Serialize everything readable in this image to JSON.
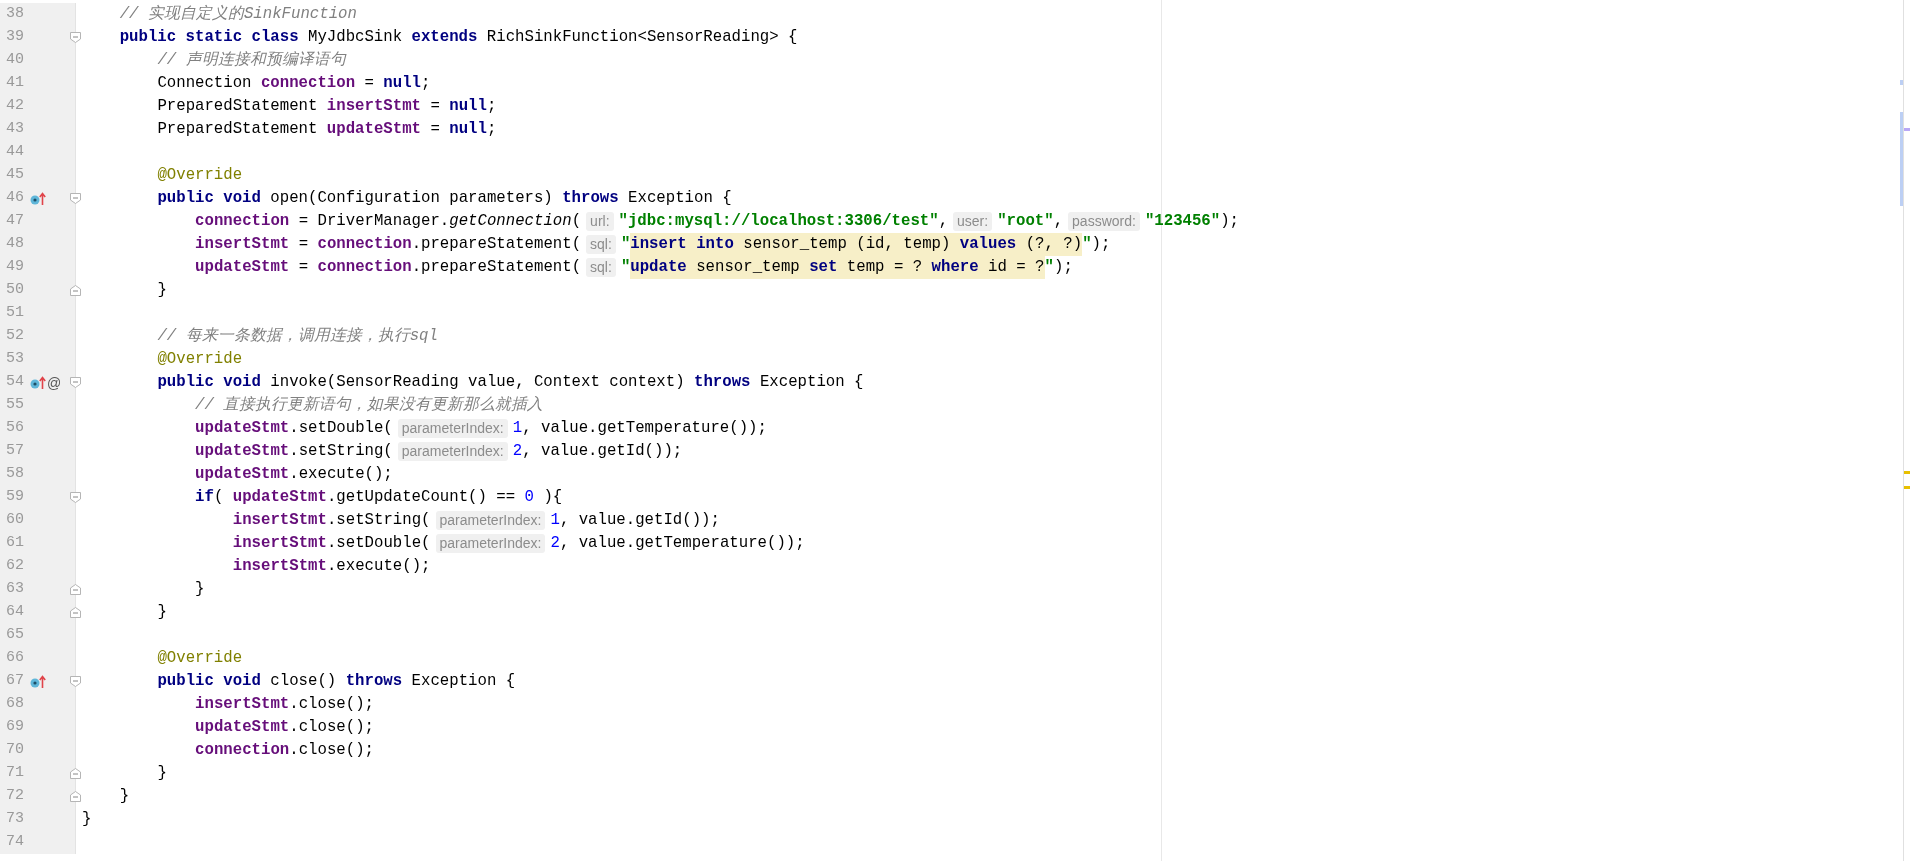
{
  "editor": {
    "lines": [
      {
        "number": "38",
        "kind": "class",
        "segments": [
          {
            "kind": "code",
            "tokens": [
              {
                "kind": "comment",
                "t": "// 实现自定义的SinkFunction"
              }
            ]
          }
        ]
      },
      {
        "number": "39",
        "fold": {
          "kind": "start"
        },
        "kind": "class",
        "segments": [
          {
            "kind": "code",
            "tokens": [
              {
                "kind": "kw",
                "t": "public static class"
              },
              {
                "kind": "plain",
                "t": " MyJdbcSink "
              },
              {
                "kind": "kw",
                "t": "extends"
              },
              {
                "kind": "plain",
                "t": " RichSinkFunction<SensorReading> {"
              }
            ]
          }
        ]
      },
      {
        "number": "40",
        "kind": "member",
        "segments": [
          {
            "kind": "code",
            "tokens": [
              {
                "kind": "comment",
                "t": "// 声明连接和预编译语句"
              }
            ]
          }
        ]
      },
      {
        "number": "41",
        "kind": "member",
        "segments": [
          {
            "kind": "code",
            "tokens": [
              {
                "kind": "plain",
                "t": "Connection "
              },
              {
                "kind": "field",
                "t": "connection"
              },
              {
                "kind": "plain",
                "t": " = "
              },
              {
                "kind": "kw",
                "t": "null"
              },
              {
                "kind": "plain",
                "t": ";"
              }
            ]
          }
        ]
      },
      {
        "number": "42",
        "kind": "member",
        "segments": [
          {
            "kind": "code",
            "tokens": [
              {
                "kind": "plain",
                "t": "PreparedStatement "
              },
              {
                "kind": "field",
                "t": "insertStmt"
              },
              {
                "kind": "plain",
                "t": " = "
              },
              {
                "kind": "kw",
                "t": "null"
              },
              {
                "kind": "plain",
                "t": ";"
              }
            ]
          }
        ]
      },
      {
        "number": "43",
        "kind": "member",
        "segments": [
          {
            "kind": "code",
            "tokens": [
              {
                "kind": "plain",
                "t": "PreparedStatement "
              },
              {
                "kind": "field",
                "t": "updateStmt"
              },
              {
                "kind": "plain",
                "t": " = "
              },
              {
                "kind": "kw",
                "t": "null"
              },
              {
                "kind": "plain",
                "t": ";"
              }
            ]
          }
        ]
      },
      {
        "number": "44"
      },
      {
        "number": "45",
        "kind": "member",
        "segments": [
          {
            "kind": "code",
            "tokens": [
              {
                "kind": "annot",
                "t": "@Override"
              }
            ]
          }
        ]
      },
      {
        "number": "46",
        "gutter": [
          {
            "kind": "override"
          }
        ],
        "fold": {
          "kind": "start"
        },
        "kind": "member",
        "segments": [
          {
            "kind": "code",
            "tokens": [
              {
                "kind": "kw",
                "t": "public void"
              },
              {
                "kind": "plain",
                "t": " open(Configuration parameters) "
              },
              {
                "kind": "kw",
                "t": "throws"
              },
              {
                "kind": "plain",
                "t": " Exception {"
              }
            ]
          }
        ]
      },
      {
        "number": "47",
        "kind": "body",
        "segments": [
          {
            "kind": "code",
            "tokens": [
              {
                "kind": "field",
                "t": "connection"
              },
              {
                "kind": "plain",
                "t": " = DriverManager."
              },
              {
                "kind": "italic",
                "t": "getConnection"
              },
              {
                "kind": "plain",
                "t": "("
              }
            ]
          },
          {
            "kind": "hint",
            "text": "url:"
          },
          {
            "kind": "code",
            "tokens": [
              {
                "kind": "str",
                "t": "\"jdbc:mysql://localhost:3306/test\""
              },
              {
                "kind": "plain",
                "t": ","
              }
            ]
          },
          {
            "kind": "hint",
            "text": "user:"
          },
          {
            "kind": "code",
            "tokens": [
              {
                "kind": "str",
                "t": "\"root\""
              },
              {
                "kind": "plain",
                "t": ","
              }
            ]
          },
          {
            "kind": "hint",
            "text": "password:"
          },
          {
            "kind": "code",
            "tokens": [
              {
                "kind": "str",
                "t": "\"123456\""
              },
              {
                "kind": "plain",
                "t": ");"
              }
            ]
          }
        ]
      },
      {
        "number": "48",
        "kind": "body",
        "segments": [
          {
            "kind": "code",
            "tokens": [
              {
                "kind": "field",
                "t": "insertStmt"
              },
              {
                "kind": "plain",
                "t": " = "
              },
              {
                "kind": "field",
                "t": "connection"
              },
              {
                "kind": "plain",
                "t": ".prepareStatement("
              }
            ]
          },
          {
            "kind": "hint",
            "text": "sql:"
          },
          {
            "kind": "code",
            "tokens": [
              {
                "kind": "str",
                "t": "\""
              }
            ]
          },
          {
            "kind": "sql",
            "tokens": [
              {
                "kind": "kw",
                "t": "insert into"
              },
              {
                "kind": "plain",
                "t": " sensor_temp (id, temp) "
              },
              {
                "kind": "kw",
                "t": "values"
              },
              {
                "kind": "plain",
                "t": " (?, ?)"
              }
            ]
          },
          {
            "kind": "code",
            "tokens": [
              {
                "kind": "str",
                "t": "\""
              },
              {
                "kind": "plain",
                "t": ");"
              }
            ]
          }
        ]
      },
      {
        "number": "49",
        "kind": "body",
        "segments": [
          {
            "kind": "code",
            "tokens": [
              {
                "kind": "field",
                "t": "updateStmt"
              },
              {
                "kind": "plain",
                "t": " = "
              },
              {
                "kind": "field",
                "t": "connection"
              },
              {
                "kind": "plain",
                "t": ".prepareStatement("
              }
            ]
          },
          {
            "kind": "hint",
            "text": "sql:"
          },
          {
            "kind": "code",
            "tokens": [
              {
                "kind": "str",
                "t": "\""
              }
            ]
          },
          {
            "kind": "sql",
            "tokens": [
              {
                "kind": "kw",
                "t": "update"
              },
              {
                "kind": "plain",
                "t": " sensor_temp "
              },
              {
                "kind": "kw",
                "t": "set"
              },
              {
                "kind": "plain",
                "t": " temp = ? "
              },
              {
                "kind": "kw",
                "t": "where"
              },
              {
                "kind": "plain",
                "t": " id = ?"
              }
            ]
          },
          {
            "kind": "code",
            "tokens": [
              {
                "kind": "str",
                "t": "\""
              },
              {
                "kind": "plain",
                "t": ");"
              }
            ]
          }
        ]
      },
      {
        "number": "50",
        "fold": {
          "kind": "end"
        },
        "kind": "member",
        "segments": [
          {
            "kind": "code",
            "tokens": [
              {
                "kind": "plain",
                "t": "}"
              }
            ]
          }
        ]
      },
      {
        "number": "51"
      },
      {
        "number": "52",
        "kind": "member",
        "segments": [
          {
            "kind": "code",
            "tokens": [
              {
                "kind": "comment",
                "t": "// 每来一条数据，调用连接，执行sql"
              }
            ]
          }
        ]
      },
      {
        "number": "53",
        "kind": "member",
        "segments": [
          {
            "kind": "code",
            "tokens": [
              {
                "kind": "annot",
                "t": "@Override"
              }
            ]
          }
        ]
      },
      {
        "number": "54",
        "gutter": [
          {
            "kind": "override"
          },
          {
            "kind": "text",
            "text": "@"
          }
        ],
        "fold": {
          "kind": "start"
        },
        "kind": "member",
        "segments": [
          {
            "kind": "code",
            "tokens": [
              {
                "kind": "kw",
                "t": "public void"
              },
              {
                "kind": "plain",
                "t": " invoke(SensorReading value, Context context) "
              },
              {
                "kind": "kw",
                "t": "throws"
              },
              {
                "kind": "plain",
                "t": " Exception {"
              }
            ]
          }
        ]
      },
      {
        "number": "55",
        "kind": "body",
        "segments": [
          {
            "kind": "code",
            "tokens": [
              {
                "kind": "comment",
                "t": "// 直接执行更新语句，如果没有更新那么就插入"
              }
            ]
          }
        ]
      },
      {
        "number": "56",
        "kind": "body",
        "segments": [
          {
            "kind": "code",
            "tokens": [
              {
                "kind": "field",
                "t": "updateStmt"
              },
              {
                "kind": "plain",
                "t": ".setDouble("
              }
            ]
          },
          {
            "kind": "hint",
            "text": "parameterIndex:"
          },
          {
            "kind": "code",
            "tokens": [
              {
                "kind": "num",
                "t": "1"
              },
              {
                "kind": "plain",
                "t": ", value.getTemperature());"
              }
            ]
          }
        ]
      },
      {
        "number": "57",
        "kind": "body",
        "segments": [
          {
            "kind": "code",
            "tokens": [
              {
                "kind": "field",
                "t": "updateStmt"
              },
              {
                "kind": "plain",
                "t": ".setString("
              }
            ]
          },
          {
            "kind": "hint",
            "text": "parameterIndex:"
          },
          {
            "kind": "code",
            "tokens": [
              {
                "kind": "num",
                "t": "2"
              },
              {
                "kind": "plain",
                "t": ", value.getId());"
              }
            ]
          }
        ]
      },
      {
        "number": "58",
        "kind": "body",
        "segments": [
          {
            "kind": "code",
            "tokens": [
              {
                "kind": "field",
                "t": "updateStmt"
              },
              {
                "kind": "plain",
                "t": ".execute();"
              }
            ]
          }
        ]
      },
      {
        "number": "59",
        "fold": {
          "kind": "start"
        },
        "kind": "body",
        "segments": [
          {
            "kind": "code",
            "tokens": [
              {
                "kind": "kw",
                "t": "if"
              },
              {
                "kind": "plain",
                "t": "( "
              },
              {
                "kind": "field",
                "t": "updateStmt"
              },
              {
                "kind": "plain",
                "t": ".getUpdateCount() == "
              },
              {
                "kind": "num",
                "t": "0"
              },
              {
                "kind": "plain",
                "t": " ){"
              }
            ]
          }
        ]
      },
      {
        "number": "60",
        "kind": "nested",
        "segments": [
          {
            "kind": "code",
            "tokens": [
              {
                "kind": "field",
                "t": "insertStmt"
              },
              {
                "kind": "plain",
                "t": ".setString("
              }
            ]
          },
          {
            "kind": "hint",
            "text": "parameterIndex:"
          },
          {
            "kind": "code",
            "tokens": [
              {
                "kind": "num",
                "t": "1"
              },
              {
                "kind": "plain",
                "t": ", value.getId());"
              }
            ]
          }
        ]
      },
      {
        "number": "61",
        "kind": "nested",
        "segments": [
          {
            "kind": "code",
            "tokens": [
              {
                "kind": "field",
                "t": "insertStmt"
              },
              {
                "kind": "plain",
                "t": ".setDouble("
              }
            ]
          },
          {
            "kind": "hint",
            "text": "parameterIndex:"
          },
          {
            "kind": "code",
            "tokens": [
              {
                "kind": "num",
                "t": "2"
              },
              {
                "kind": "plain",
                "t": ", value.getTemperature());"
              }
            ]
          }
        ]
      },
      {
        "number": "62",
        "kind": "nested",
        "segments": [
          {
            "kind": "code",
            "tokens": [
              {
                "kind": "field",
                "t": "insertStmt"
              },
              {
                "kind": "plain",
                "t": ".execute();"
              }
            ]
          }
        ]
      },
      {
        "number": "63",
        "fold": {
          "kind": "end"
        },
        "kind": "body",
        "segments": [
          {
            "kind": "code",
            "tokens": [
              {
                "kind": "plain",
                "t": "}"
              }
            ]
          }
        ]
      },
      {
        "number": "64",
        "fold": {
          "kind": "end"
        },
        "kind": "member",
        "segments": [
          {
            "kind": "code",
            "tokens": [
              {
                "kind": "plain",
                "t": "}"
              }
            ]
          }
        ]
      },
      {
        "number": "65"
      },
      {
        "number": "66",
        "kind": "member",
        "segments": [
          {
            "kind": "code",
            "tokens": [
              {
                "kind": "annot",
                "t": "@Override"
              }
            ]
          }
        ]
      },
      {
        "number": "67",
        "gutter": [
          {
            "kind": "override"
          }
        ],
        "fold": {
          "kind": "start"
        },
        "kind": "member",
        "segments": [
          {
            "kind": "code",
            "tokens": [
              {
                "kind": "kw",
                "t": "public void"
              },
              {
                "kind": "plain",
                "t": " close() "
              },
              {
                "kind": "kw",
                "t": "throws"
              },
              {
                "kind": "plain",
                "t": " Exception {"
              }
            ]
          }
        ]
      },
      {
        "number": "68",
        "kind": "body",
        "segments": [
          {
            "kind": "code",
            "tokens": [
              {
                "kind": "field",
                "t": "insertStmt"
              },
              {
                "kind": "plain",
                "t": ".close();"
              }
            ]
          }
        ]
      },
      {
        "number": "69",
        "kind": "body",
        "segments": [
          {
            "kind": "code",
            "tokens": [
              {
                "kind": "field",
                "t": "updateStmt"
              },
              {
                "kind": "plain",
                "t": ".close();"
              }
            ]
          }
        ]
      },
      {
        "number": "70",
        "kind": "body",
        "segments": [
          {
            "kind": "code",
            "tokens": [
              {
                "kind": "field",
                "t": "connection"
              },
              {
                "kind": "plain",
                "t": ".close();"
              }
            ]
          }
        ]
      },
      {
        "number": "71",
        "fold": {
          "kind": "end"
        },
        "kind": "member",
        "segments": [
          {
            "kind": "code",
            "tokens": [
              {
                "kind": "plain",
                "t": "}"
              }
            ]
          }
        ]
      },
      {
        "number": "72",
        "fold": {
          "kind": "end"
        },
        "kind": "class",
        "segments": [
          {
            "kind": "code",
            "tokens": [
              {
                "kind": "plain",
                "t": "}"
              }
            ]
          }
        ]
      },
      {
        "number": "73",
        "kind": "top",
        "segments": [
          {
            "kind": "code",
            "tokens": [
              {
                "kind": "plain",
                "t": "}"
              }
            ]
          }
        ]
      },
      {
        "number": "74"
      }
    ]
  }
}
